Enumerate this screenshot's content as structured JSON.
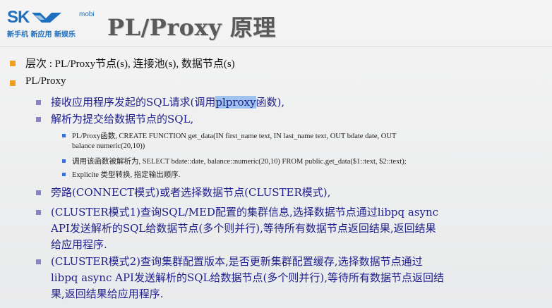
{
  "logo": {
    "mark": "SK",
    "mobi": "mobi",
    "slogan": "新手机 新应用 新娱乐"
  },
  "title": "PL/Proxy 原理",
  "bullets": [
    {
      "text": "层次 : PL/Proxy节点(s), 连接池(s), 数据节点(s)"
    },
    {
      "text": "PL/Proxy"
    }
  ],
  "sub_items": {
    "item1_pre": "接收应用程序发起的SQL请求(调用",
    "item1_hl": "plproxy",
    "item1_post": "函数),",
    "item2": "解析为提交给数据节点的SQL,",
    "detail1_line1": "PL/Proxy函数, CREATE FUNCTION get_data(IN first_name text, IN last_name text, OUT bdate date, OUT",
    "detail1_line2": "balance numeric(20,10))",
    "detail2": "调用该函数被解析为, SELECT bdate::date, balance::numeric(20,10) FROM public.get_data($1::text, $2::text);",
    "detail3": "Explicite 类型转换, 指定输出顺序.",
    "item3": "旁路(CONNECT模式)或者选择数据节点(CLUSTER模式),",
    "item4_line1": "(CLUSTER模式1)查询SQL/MED配置的集群信息,选择数据节点通过libpq async",
    "item4_line2": "API发送解析的SQL给数据节点(多个则并行),等待所有数据节点返回结果,返回结果",
    "item4_line3": "给应用程序.",
    "item5_line1": "(CLUSTER模式2)查询集群配置版本,是否更新集群配置缓存,选择数据节点通过",
    "item5_line2": "libpq async API发送解析的SQL给数据节点(多个则并行),等待所有数据节点返回结",
    "item5_line3": "果,返回结果给应用程序."
  },
  "colors": {
    "accent_orange": "#f0a020",
    "sub_bullet_purple": "#8a82c8",
    "detail_bullet_blue": "#3a6fd8",
    "sub_text_navy": "#1e1e8c",
    "highlight": "#9fc3ee"
  }
}
